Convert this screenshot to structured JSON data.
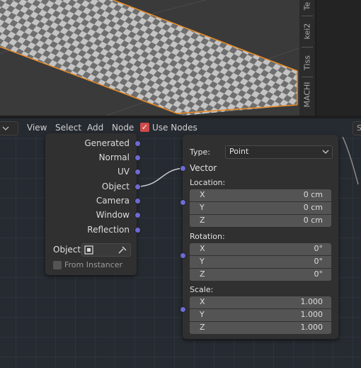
{
  "viewport": {
    "side_tabs": [
      "Te",
      "kei2",
      "Tiss",
      "MACHI"
    ]
  },
  "header": {
    "menu": [
      "View",
      "Select",
      "Add",
      "Node"
    ],
    "use_nodes_label": "Use Nodes",
    "use_nodes_checked": true,
    "right_dropdown_glyph": "S"
  },
  "texcoord_node": {
    "outputs": [
      "Generated",
      "Normal",
      "UV",
      "Object",
      "Camera",
      "Window",
      "Reflection"
    ],
    "object_label": "Object:",
    "from_instancer_label": "From Instancer"
  },
  "mapping_node": {
    "type_label": "Type:",
    "type_value": "Point",
    "vector_label": "Vector",
    "location_label": "Location:",
    "location": [
      {
        "axis": "X",
        "value": "0 cm"
      },
      {
        "axis": "Y",
        "value": "0 cm"
      },
      {
        "axis": "Z",
        "value": "0 cm"
      }
    ],
    "rotation_label": "Rotation:",
    "rotation": [
      {
        "axis": "X",
        "value": "0°"
      },
      {
        "axis": "Y",
        "value": "0°"
      },
      {
        "axis": "Z",
        "value": "0°"
      }
    ],
    "scale_label": "Scale:",
    "scale": [
      {
        "axis": "X",
        "value": "1.000"
      },
      {
        "axis": "Y",
        "value": "1.000"
      },
      {
        "axis": "Z",
        "value": "1.000"
      }
    ]
  },
  "colors": {
    "socket_vector": "#6d6ad6",
    "selection_outline": "#e88a25",
    "checkbox": "#cf4a4a"
  }
}
